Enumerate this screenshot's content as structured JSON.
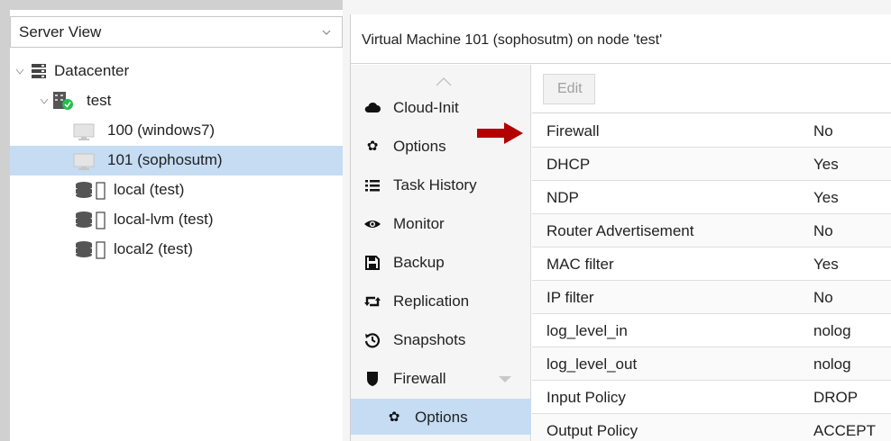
{
  "server_view": {
    "selected": "Server View",
    "tree": [
      {
        "label": "Datacenter",
        "icon": "datacenter-icon",
        "level": 0
      },
      {
        "label": "test",
        "icon": "node-online-icon",
        "level": 1
      },
      {
        "label": "100 (windows7)",
        "icon": "vm-stopped-icon",
        "level": 2
      },
      {
        "label": "101 (sophosutm)",
        "icon": "vm-stopped-icon",
        "level": 2,
        "selected": true
      },
      {
        "label": "local (test)",
        "icon": "storage-icon",
        "level": 2
      },
      {
        "label": "local-lvm (test)",
        "icon": "storage-icon",
        "level": 2
      },
      {
        "label": "local2 (test)",
        "icon": "storage-icon",
        "level": 2
      }
    ]
  },
  "header": {
    "title": "Virtual Machine 101 (sophosutm) on node 'test'"
  },
  "nav": {
    "items": [
      {
        "label": "Cloud-Init",
        "icon": "cloud-icon"
      },
      {
        "label": "Options",
        "icon": "gear-icon"
      },
      {
        "label": "Task History",
        "icon": "list-icon"
      },
      {
        "label": "Monitor",
        "icon": "eye-icon"
      },
      {
        "label": "Backup",
        "icon": "floppy-icon"
      },
      {
        "label": "Replication",
        "icon": "retweet-icon"
      },
      {
        "label": "Snapshots",
        "icon": "history-icon"
      },
      {
        "label": "Firewall",
        "icon": "shield-icon",
        "expandable": true
      },
      {
        "label": "Options",
        "icon": "gear-icon",
        "sub": true,
        "active": true
      }
    ]
  },
  "toolbar": {
    "edit_label": "Edit"
  },
  "firewall_options": {
    "rows": [
      {
        "key": "Firewall",
        "value": "No"
      },
      {
        "key": "DHCP",
        "value": "Yes"
      },
      {
        "key": "NDP",
        "value": "Yes"
      },
      {
        "key": "Router Advertisement",
        "value": "No"
      },
      {
        "key": "MAC filter",
        "value": "Yes"
      },
      {
        "key": "IP filter",
        "value": "No"
      },
      {
        "key": "log_level_in",
        "value": "nolog"
      },
      {
        "key": "log_level_out",
        "value": "nolog"
      },
      {
        "key": "Input Policy",
        "value": "DROP"
      },
      {
        "key": "Output Policy",
        "value": "ACCEPT"
      }
    ]
  },
  "colors": {
    "selection": "#c5dcf3",
    "annotation_arrow": "#b30000",
    "node_status_ok": "#21bf4b"
  }
}
